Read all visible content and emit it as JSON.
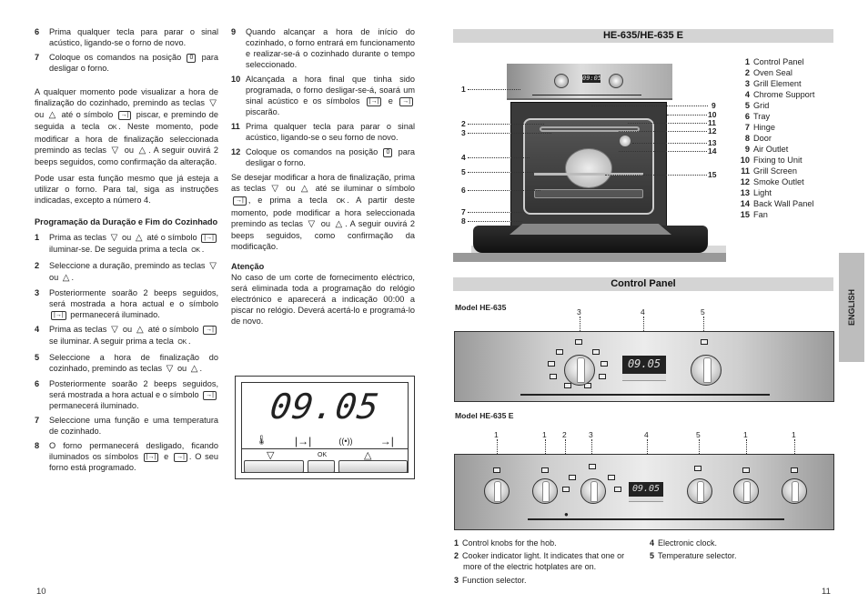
{
  "left_page": {
    "page_number": "10",
    "col1": {
      "intro_steps": [
        {
          "n": "6",
          "text": "Prima qualquer tecla para parar o sinal acústico, ligando-se o forno de novo."
        },
        {
          "n": "7",
          "text_before": "Coloque os comandos na posição",
          "symbol": "0",
          "text_after": "para desligar o forno."
        }
      ],
      "para1_parts": [
        "A qualquer momento pode visualizar a hora de finalização do cozinhado, premindo as teclas",
        "▽",
        "ou",
        "△",
        "até o símbolo",
        "→|",
        "piscar, e premindo de seguida a tecla",
        "OK",
        ". Neste momento, pode modificar a hora de finalização seleccionada premindo as teclas",
        "▽",
        "ou",
        "△",
        ". A seguir ouvirá 2 beeps seguidos, como confirmação da alteração."
      ],
      "para2": "Pode usar esta função mesmo que já esteja a utilizar o forno. Para tal, siga as instruções indicadas, excepto a número 4.",
      "heading": "Programação da Duração e Fim do Cozinhado",
      "steps": [
        {
          "n": "1",
          "parts": [
            "Prima as teclas",
            "▽",
            "ou",
            "△",
            "até o símbolo",
            "|→|",
            "iluminar-se. De seguida prima a tecla",
            "OK",
            "."
          ]
        },
        {
          "n": "2",
          "parts": [
            "Seleccione a duração, premindo as teclas",
            "▽",
            "ou",
            "△",
            "."
          ]
        },
        {
          "n": "3",
          "parts": [
            "Posteriormente soarão 2 beeps seguidos, será mostrada a hora actual e o símbolo",
            "|→|",
            "permanecerá iluminado."
          ]
        },
        {
          "n": "4",
          "parts": [
            "Prima as teclas",
            "▽",
            "ou",
            "△",
            "até o símbolo",
            "→|",
            "se iluminar. A seguir prima a tecla",
            "OK",
            "."
          ]
        },
        {
          "n": "5",
          "parts": [
            "Seleccione a hora de finalização do cozinhado, premindo as teclas",
            "▽",
            "ou",
            "△",
            "."
          ]
        },
        {
          "n": "6",
          "parts": [
            "Posteriormente soarão 2 beeps seguidos, será mostrada a hora actual e o símbolo",
            "→|",
            "permanecerá iluminado."
          ]
        },
        {
          "n": "7",
          "parts": [
            "Seleccione uma função e uma temperatura de cozinhado."
          ]
        },
        {
          "n": "8",
          "parts": [
            "O forno permanecerá desligado, ficando iluminados os símbolos",
            "|→|",
            "e",
            "→|",
            ". O seu forno está programado."
          ]
        }
      ]
    },
    "col2": {
      "steps": [
        {
          "n": "9",
          "parts": [
            "Quando alcançar a hora de início do cozinhado, o forno entrará em funcionamento e realizar-se-á o cozinhado durante o tempo seleccionado."
          ]
        },
        {
          "n": "10",
          "parts": [
            "Alcançada a hora final que tinha sido programada, o forno desligar-se-á, soará um sinal acústico e os símbolos",
            "|→|",
            "e",
            "→|",
            "piscarão."
          ]
        },
        {
          "n": "11",
          "parts": [
            "Prima qualquer tecla para parar o sinal acústico, ligando-se o seu forno de novo."
          ]
        },
        {
          "n": "12",
          "parts": [
            "Coloque os comandos na posição",
            "0",
            "para desligar o forno."
          ]
        }
      ],
      "para_parts": [
        "Se desejar modificar a hora de finalização, prima as teclas",
        "▽",
        "ou",
        "△",
        "até se iluminar o símbolo",
        "→|",
        ", e prima a tecla",
        "OK",
        ". A partir deste momento, pode modificar a hora seleccionada premindo as teclas",
        "▽",
        "ou",
        "△",
        ". A seguir ouvirá 2 beeps seguidos, como confirmação da modificação."
      ],
      "attention_title": "Atenção",
      "attention_text": "No caso de um corte de fornecimento eléctrico, será eliminada toda a programação do relógio electrónico e aparecerá a indicação 00:00 a piscar no relógio. Deverá acertá-lo e programá-lo de novo."
    },
    "clock_figure": {
      "time": "09.05",
      "icons": [
        "🌡",
        "|→|",
        "((•))",
        "→|"
      ],
      "icon_names": [
        "thermometer-icon",
        "duration-icon",
        "alarm-icon",
        "end-time-icon"
      ],
      "keys": [
        {
          "label": "▽",
          "name": "down-key"
        },
        {
          "label": "OK",
          "name": "ok-key"
        },
        {
          "label": "△",
          "name": "up-key"
        }
      ]
    }
  },
  "right_page": {
    "page_number": "11",
    "title": "HE-635/HE-635 E",
    "oven_callouts_left": [
      "1",
      "2",
      "3",
      "4",
      "5",
      "6",
      "7",
      "8"
    ],
    "oven_callouts_right": [
      "9",
      "10",
      "11",
      "12",
      "13",
      "14",
      "15"
    ],
    "oven_display": "09:05",
    "legend": [
      {
        "n": "1",
        "label": "Control Panel"
      },
      {
        "n": "2",
        "label": "Oven Seal"
      },
      {
        "n": "3",
        "label": "Grill Element"
      },
      {
        "n": "4",
        "label": "Chrome Support"
      },
      {
        "n": "5",
        "label": "Grid"
      },
      {
        "n": "6",
        "label": "Tray"
      },
      {
        "n": "7",
        "label": "Hinge"
      },
      {
        "n": "8",
        "label": "Door"
      },
      {
        "n": "9",
        "label": "Air Outlet"
      },
      {
        "n": "10",
        "label": "Fixing to Unit"
      },
      {
        "n": "11",
        "label": "Grill Screen"
      },
      {
        "n": "12",
        "label": "Smoke Outlet"
      },
      {
        "n": "13",
        "label": "Light"
      },
      {
        "n": "14",
        "label": "Back Wall Panel"
      },
      {
        "n": "15",
        "label": "Fan"
      }
    ],
    "control_panel_title": "Control Panel",
    "model1": {
      "label": "Model HE-635",
      "callouts": [
        "3",
        "4",
        "5"
      ],
      "display": "09.05"
    },
    "model2": {
      "label": "Model HE-635 E",
      "callouts": [
        "1",
        "1",
        "2",
        "3",
        "4",
        "5",
        "1",
        "1"
      ],
      "display": "09.05"
    },
    "captions_left": [
      {
        "n": "1",
        "text": "Control knobs for the hob."
      },
      {
        "n": "2",
        "text": "Cooker indicator light. It indicates that one or more of the electric hotplates are on."
      },
      {
        "n": "3",
        "text": "Function selector."
      }
    ],
    "captions_right": [
      {
        "n": "4",
        "text": "Electronic clock."
      },
      {
        "n": "5",
        "text": "Temperature selector."
      }
    ],
    "side_tab": "ENGLISH"
  }
}
